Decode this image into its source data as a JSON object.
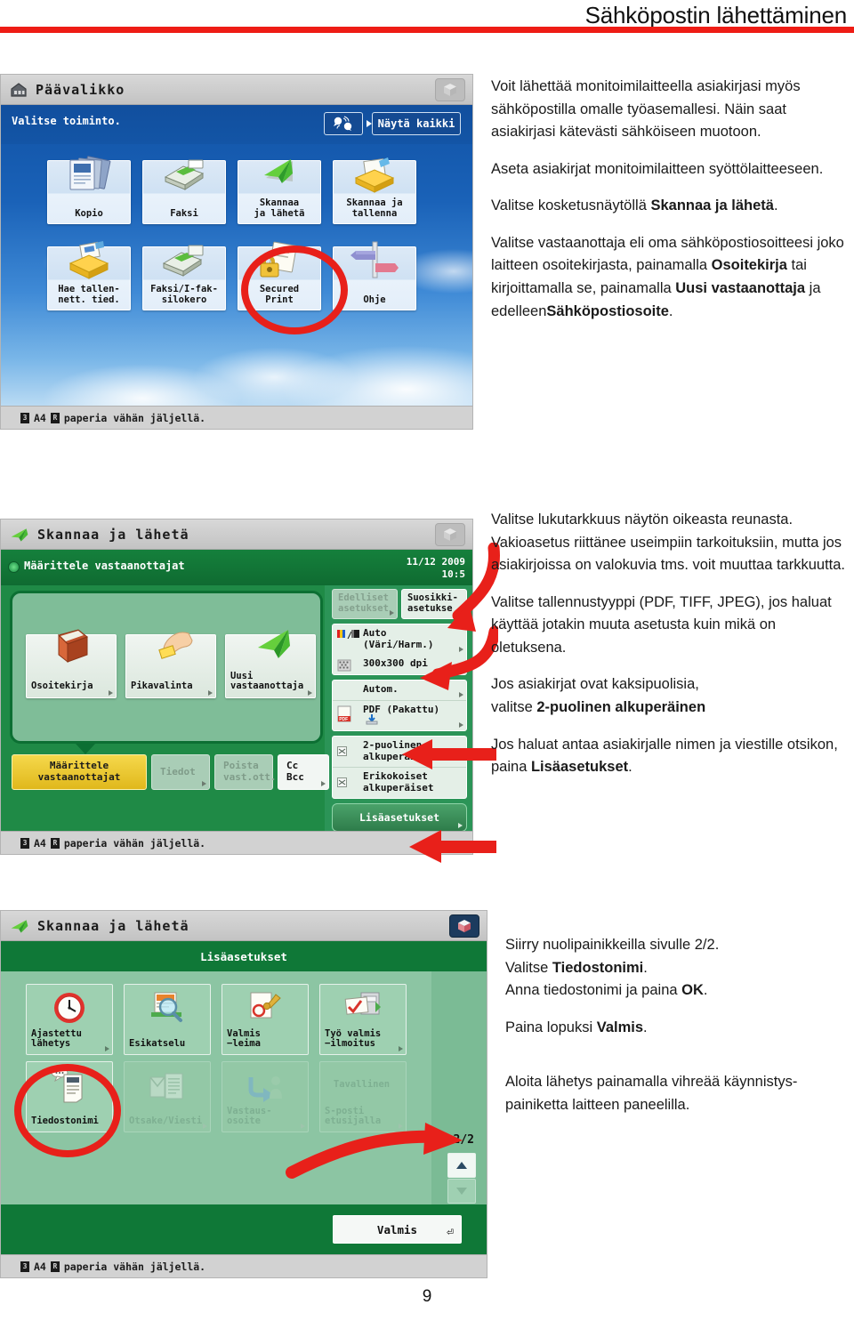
{
  "document": {
    "title": "Sähköpostin lähettäminen",
    "page_number": "9",
    "accent_color": "#ee1c15"
  },
  "section1": {
    "panel": {
      "titlebar": "Päävalikko",
      "prompt": "Valitse toiminto.",
      "show_all_button": "Näytä kaikki",
      "status": "paperia vähän jäljellä.",
      "status_tray": "3",
      "status_paper": "A4",
      "tiles": [
        {
          "label": "Kopio",
          "icon": "documents-icon"
        },
        {
          "label": "Faksi",
          "icon": "fax-icon"
        },
        {
          "label": "Skannaa\nja lähetä",
          "icon": "green-paper-plane-icon",
          "highlighted": true
        },
        {
          "label": "Skannaa ja\ntallenna",
          "icon": "yellow-tray-icon"
        },
        {
          "label": "Hae tallen-\nnett. tied.",
          "icon": "yellow-box-icon"
        },
        {
          "label": "Faksi/I-fak-\nsilokero",
          "icon": "fax-inbox-icon"
        },
        {
          "label": "Secured\nPrint",
          "icon": "padlock-document-icon"
        },
        {
          "label": "Ohje",
          "icon": "signpost-icon"
        }
      ]
    },
    "text": {
      "p1": "Voit lähettää monitoimilaitteella asiakirjasi myös sähköpostilla omalle työasemallesi. Näin saat asiakirjasi kätevästi sähköiseen muotoon.",
      "p2": "Aseta asiakirjat monitoimilaitteen syöttölaitteeseen.",
      "p3_pre": "Valitse kosketusnäytöllä ",
      "p3_bold": "Skannaa ja lähetä",
      "p3_post": ".",
      "p4_a": "Valitse vastaanottaja eli oma sähköpostiosoitteesi joko laitteen osoitekirjasta, painamalla ",
      "p4_b1": "Osoitekirja",
      "p4_c": " tai kirjoittamalla se, painamalla ",
      "p4_b2": "Uusi vastaanottaja",
      "p4_d": " ja edelleen",
      "p4_b3": "Sähköpostiosoite",
      "p4_e": "."
    }
  },
  "section2": {
    "panel": {
      "titlebar": "Skannaa ja lähetä",
      "subheader": "Määrittele vastaanottajat",
      "date": "11/12 2009",
      "time": "10:5",
      "status": "paperia vähän jäljellä.",
      "status_tray": "3",
      "status_paper": "A4",
      "destination_buttons": [
        {
          "label": "Osoitekirja",
          "icon": "address-book-icon"
        },
        {
          "label": "Pikavalinta",
          "icon": "hand-card-icon"
        },
        {
          "label": "Uusi\nvastaanottaja",
          "icon": "green-paper-plane-icon"
        }
      ],
      "lower_buttons": [
        {
          "label": "Määrittele\nvastaanottajat",
          "state": "selected"
        },
        {
          "label": "Tiedot",
          "state": "disabled"
        },
        {
          "label": "Poista\nvast.ott.",
          "state": "disabled"
        },
        {
          "label": "Cc\nBcc",
          "state": "enabled"
        }
      ],
      "settings": {
        "prev_settings": "Edelliset\nasetukset",
        "fav_settings": "Suosikki-\nasetukse",
        "color_mode": "Auto\n(Väri/Harm.)",
        "resolution": "300x300 dpi",
        "scan_size": "Autom.",
        "file_format": "PDF (Pakattu)",
        "two_sided": "2-puolinen\nalkuperäinen",
        "mixed_size": "Erikokoiset\nalkuperäiset",
        "more_settings": "Lisäasetukset"
      }
    },
    "text": {
      "p1": "Valitse lukutarkkuus näytön oikeasta reunasta. Vakioasetus riittänee useimpiin tarkoituksiin, mutta jos asiakirjoissa on valokuvia tms. voit muuttaa tarkkuutta.",
      "p2": "Valitse tallennustyyppi (PDF, TIFF, JPEG), jos haluat käyttää jotakin muuta asetusta kuin mikä on oletuksena.",
      "p3_a": "Jos asiakirjat ovat kaksipuolisia,\nvalitse ",
      "p3_b": "2-puolinen alkuperäinen",
      "p4_a": " Jos haluat antaa asiakirjalle nimen ja viestille otsikon, paina ",
      "p4_b": "Lisäasetukset",
      "p4_c": "."
    }
  },
  "section3": {
    "panel": {
      "titlebar": "Skannaa ja lähetä",
      "subheader": "Lisäasetukset",
      "status": "paperia vähän jäljellä.",
      "status_tray": "3",
      "status_paper": "A4",
      "page_indicator": "2/2",
      "done_button": "Valmis",
      "tiles": [
        {
          "label": "Ajastettu\nlähetys",
          "icon": "clock-icon",
          "state": "enabled"
        },
        {
          "label": "Esikatselu",
          "icon": "magnifier-preview-icon",
          "state": "enabled"
        },
        {
          "label": "Valmis\n−leima",
          "icon": "stamp-icon",
          "state": "enabled"
        },
        {
          "label": "Työ valmis\n−ilmoitus",
          "icon": "job-done-notice-icon",
          "state": "enabled"
        },
        {
          "label": "Tiedostonimi",
          "icon": "file-name-icon",
          "state": "enabled",
          "highlighted": true
        },
        {
          "label": "Otsake/Viesti",
          "icon": "message-icon",
          "state": "disabled"
        },
        {
          "label": "Vastaus-\nosoite",
          "icon": "reply-address-icon",
          "state": "disabled"
        },
        {
          "label": "S-posti\netusijalla",
          "icon": "priority-icon",
          "state": "disabled",
          "top_label": "Tavallinen"
        }
      ]
    },
    "text": {
      "p1": "Siirry nuolipainikkeilla sivulle 2/2.",
      "p2_a": "Valitse ",
      "p2_b": "Tiedostonimi",
      "p2_c": ".",
      "p3_a": "Anna tiedostonimi ja paina ",
      "p3_b": "OK",
      "p3_c": ".",
      "p4_a": "Paina lopuksi ",
      "p4_b": "Valmis",
      "p4_c": ".",
      "p5": "Aloita lähetys painamalla vihreää käynnistys-painiketta laitteen paneelilla."
    }
  }
}
